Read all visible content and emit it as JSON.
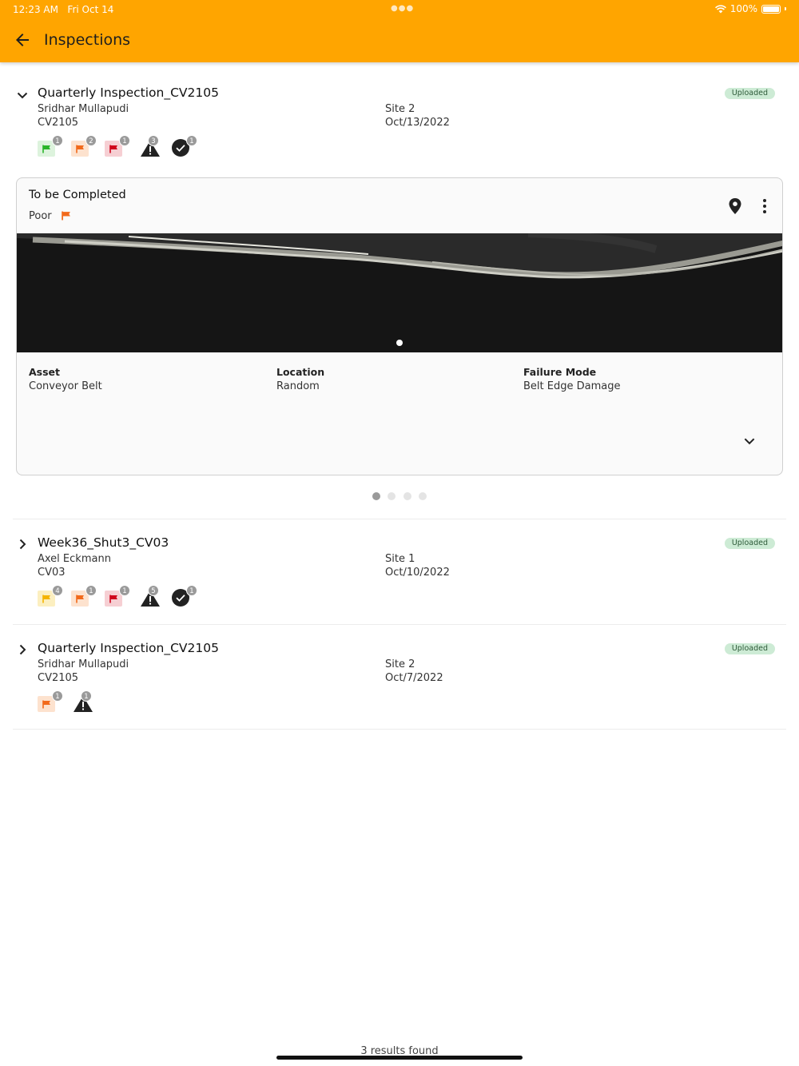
{
  "status": {
    "time": "12:23 AM",
    "date": "Fri Oct 14",
    "battery": "100%"
  },
  "header": {
    "title": "Inspections"
  },
  "inspections": [
    {
      "title": "Quarterly Inspection_CV2105",
      "inspector": "Sridhar Mullapudi",
      "asset_code": "CV2105",
      "site": "Site 2",
      "date": "Oct/13/2022",
      "status": "Uploaded",
      "counts": {
        "green": "1",
        "orange": "2",
        "red": "1",
        "warning": "3",
        "done": "1"
      }
    },
    {
      "title": "Week36_Shut3_CV03",
      "inspector": "Axel Eckmann",
      "asset_code": "CV03",
      "site": "Site 1",
      "date": "Oct/10/2022",
      "status": "Uploaded",
      "counts": {
        "yellow": "4",
        "orange": "1",
        "red": "1",
        "warning": "5",
        "done": "1"
      }
    },
    {
      "title": "Quarterly Inspection_CV2105",
      "inspector": "Sridhar Mullapudi",
      "asset_code": "CV2105",
      "site": "Site 2",
      "date": "Oct/7/2022",
      "status": "Uploaded",
      "counts": {
        "orange": "1",
        "warning": "1"
      }
    }
  ],
  "card": {
    "title": "To be Completed",
    "condition": "Poor",
    "fields": [
      {
        "label": "Asset",
        "value": "Conveyor Belt"
      },
      {
        "label": "Location",
        "value": "Random"
      },
      {
        "label": "Failure Mode",
        "value": "Belt Edge Damage"
      }
    ]
  },
  "pager": {
    "total": 4,
    "active": 0
  },
  "footer": {
    "results": "3 results found"
  },
  "colors": {
    "accent": "#FFA500",
    "badge_bg": "#CDEBD5",
    "flag_green": "#2BB52B",
    "flag_yellow": "#F4B400",
    "flag_orange": "#F26A1B",
    "flag_red": "#D0021B"
  }
}
